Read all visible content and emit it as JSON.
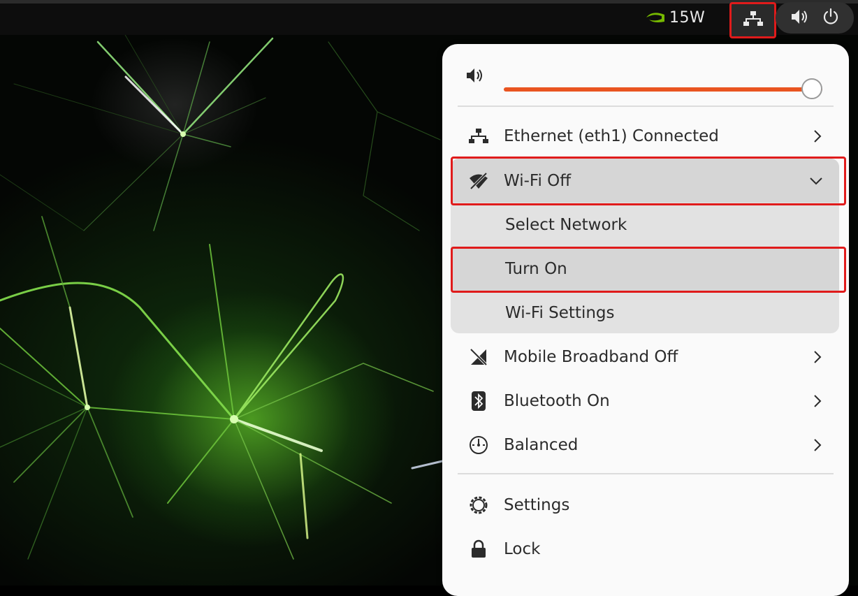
{
  "topbar": {
    "nvidia_icon": "nvidia-logo-icon",
    "power_mode": "15W",
    "network_icon": "wired-network-icon",
    "sound_icon": "speaker-icon",
    "power_icon": "power-icon"
  },
  "quick_menu": {
    "volume": {
      "icon": "speaker-icon",
      "level": 1.0,
      "accent": "#E95420"
    },
    "ethernet": {
      "icon": "wired-network-icon",
      "label": "Ethernet (eth1) Connected"
    },
    "wifi": {
      "icon": "wifi-off-icon",
      "label": "Wi-Fi Off",
      "submenu": {
        "select_network": "Select Network",
        "turn_on": "Turn On",
        "settings": "Wi-Fi Settings"
      }
    },
    "mobile_broadband": {
      "icon": "mobile-broadband-off-icon",
      "label": "Mobile Broadband Off"
    },
    "bluetooth": {
      "icon": "bluetooth-icon",
      "label": "Bluetooth On"
    },
    "power_profile": {
      "icon": "speedometer-icon",
      "label": "Balanced"
    },
    "settings": {
      "icon": "gear-icon",
      "label": "Settings"
    },
    "lock": {
      "icon": "lock-icon",
      "label": "Lock"
    }
  },
  "highlight_color": "#E01B1B"
}
